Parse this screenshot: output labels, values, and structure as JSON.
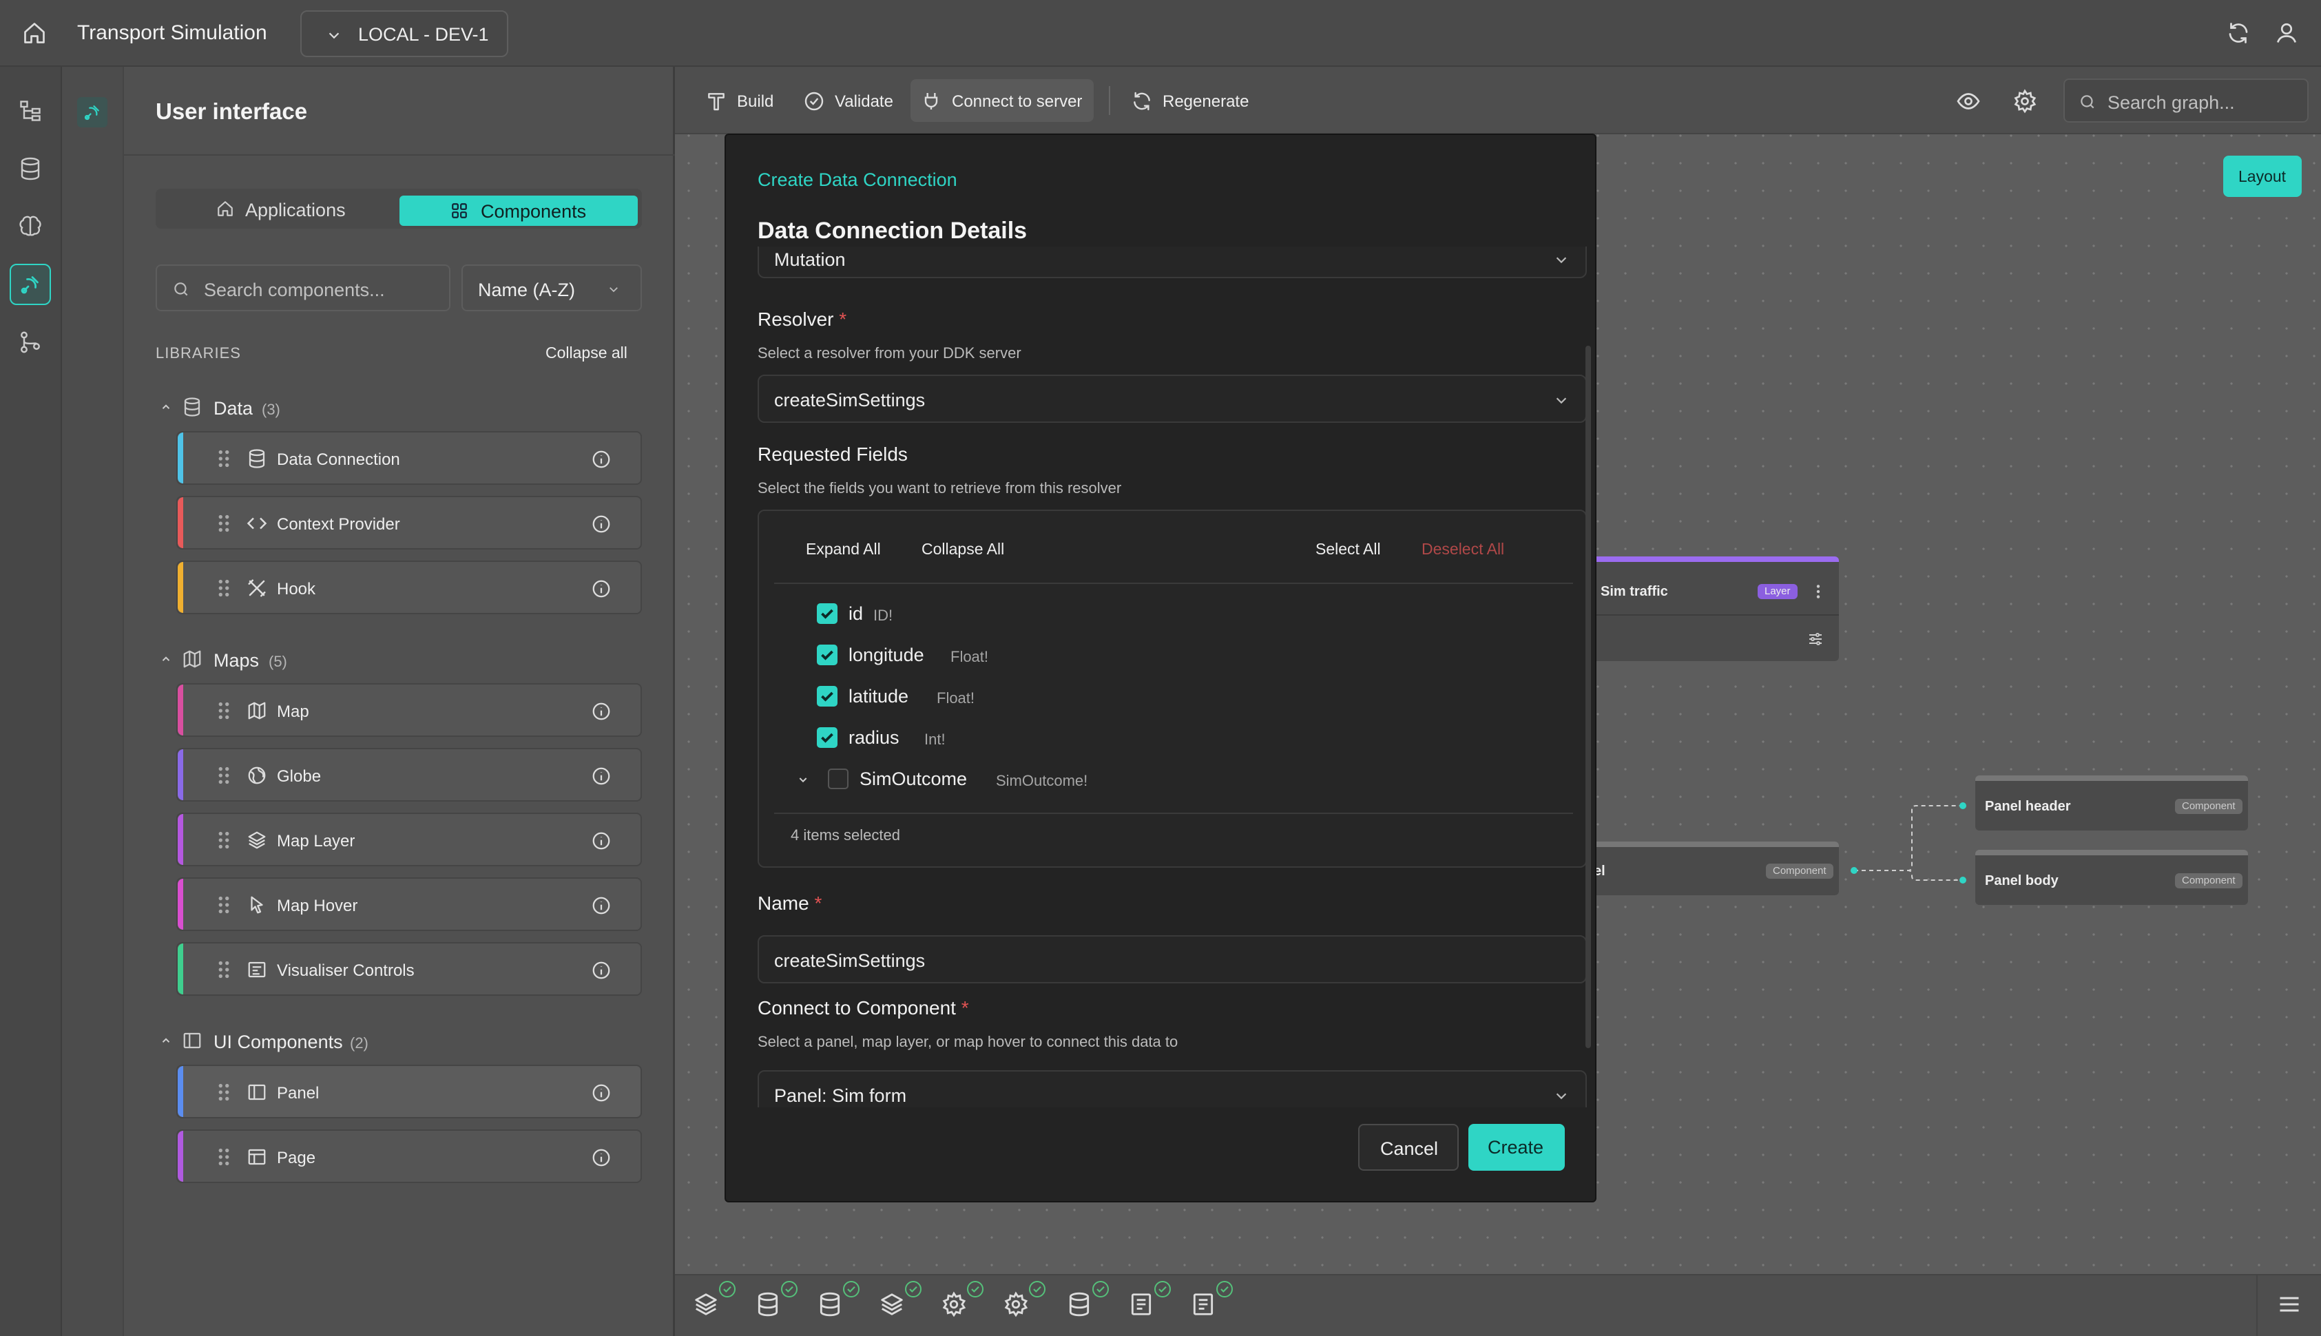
{
  "app": {
    "title": "Transport Simulation",
    "environment": "LOCAL - DEV-1"
  },
  "colors": {
    "accent": "#2fd5c5",
    "danger": "#e25353",
    "layer_purple": "#9b6cf0"
  },
  "sidebar": {
    "title": "User interface",
    "tabs": [
      {
        "label": "Applications",
        "active": false
      },
      {
        "label": "Components",
        "active": true
      }
    ],
    "search_placeholder": "Search components...",
    "sort_label": "Name (A-Z)",
    "libraries_heading": "LIBRARIES",
    "collapse_all": "Collapse all",
    "groups": [
      {
        "name": "Data",
        "count": "(3)",
        "icon": "database-icon",
        "items": [
          {
            "label": "Data Connection",
            "icon": "database-icon",
            "color": "#4fc3e8"
          },
          {
            "label": "Context Provider",
            "icon": "code-icon",
            "color": "#e85a5a"
          },
          {
            "label": "Hook",
            "icon": "tools-icon",
            "color": "#f0b030"
          }
        ]
      },
      {
        "name": "Maps",
        "count": "(5)",
        "icon": "map-icon",
        "items": [
          {
            "label": "Map",
            "icon": "map-icon",
            "color": "#d94fa0"
          },
          {
            "label": "Globe",
            "icon": "globe-icon",
            "color": "#8a6ae8"
          },
          {
            "label": "Map Layer",
            "icon": "layers-icon",
            "color": "#b558e0"
          },
          {
            "label": "Map Hover",
            "icon": "pointer-icon",
            "color": "#d94fd0"
          },
          {
            "label": "Visualiser Controls",
            "icon": "controls-icon",
            "color": "#3fcf8e"
          }
        ]
      },
      {
        "name": "UI Components",
        "count": "(2)",
        "icon": "panel-icon",
        "items": [
          {
            "label": "Panel",
            "icon": "panel-icon",
            "color": "#5b8df0"
          },
          {
            "label": "Page",
            "icon": "page-icon",
            "color": "#b05ae0"
          }
        ]
      }
    ]
  },
  "toolbar": {
    "build": "Build",
    "validate": "Validate",
    "connect": "Connect to server",
    "regenerate": "Regenerate",
    "search_placeholder": "Search graph...",
    "layout": "Layout"
  },
  "graph": {
    "nodes": [
      {
        "title": "Sim traffic",
        "badge": "Layer"
      },
      {
        "title": "el",
        "badge": "Component"
      },
      {
        "title": "Panel header",
        "badge": "Component"
      },
      {
        "title": "Panel body",
        "badge": "Component"
      }
    ]
  },
  "modal": {
    "breadcrumb": "Create Data Connection",
    "title": "Data Connection Details",
    "operation_value": "Mutation",
    "resolver": {
      "label": "Resolver",
      "hint": "Select a resolver from your DDK server",
      "value": "createSimSettings"
    },
    "requested_fields": {
      "label": "Requested Fields",
      "hint": "Select the fields you want to retrieve from this resolver",
      "expand_all": "Expand All",
      "collapse_all": "Collapse All",
      "select_all": "Select All",
      "deselect_all": "Deselect All",
      "fields": [
        {
          "name": "id",
          "type": "ID!",
          "checked": true
        },
        {
          "name": "longitude",
          "type": "Float!",
          "checked": true
        },
        {
          "name": "latitude",
          "type": "Float!",
          "checked": true
        },
        {
          "name": "radius",
          "type": "Int!",
          "checked": true
        },
        {
          "name": "SimOutcome",
          "type": "SimOutcome!",
          "checked": false
        }
      ],
      "summary": "4 items selected"
    },
    "name": {
      "label": "Name",
      "value": "createSimSettings"
    },
    "connect_to": {
      "label": "Connect to Component",
      "hint": "Select a panel, map layer, or map hover to connect this data to",
      "value": "Panel: Sim form"
    },
    "cancel": "Cancel",
    "create": "Create"
  },
  "bottom_bar": {
    "icons": [
      "layers-icon",
      "database-icon",
      "database-icon",
      "layers-icon",
      "gear-icon",
      "gear-icon",
      "database-icon",
      "document-icon",
      "document-icon"
    ]
  }
}
